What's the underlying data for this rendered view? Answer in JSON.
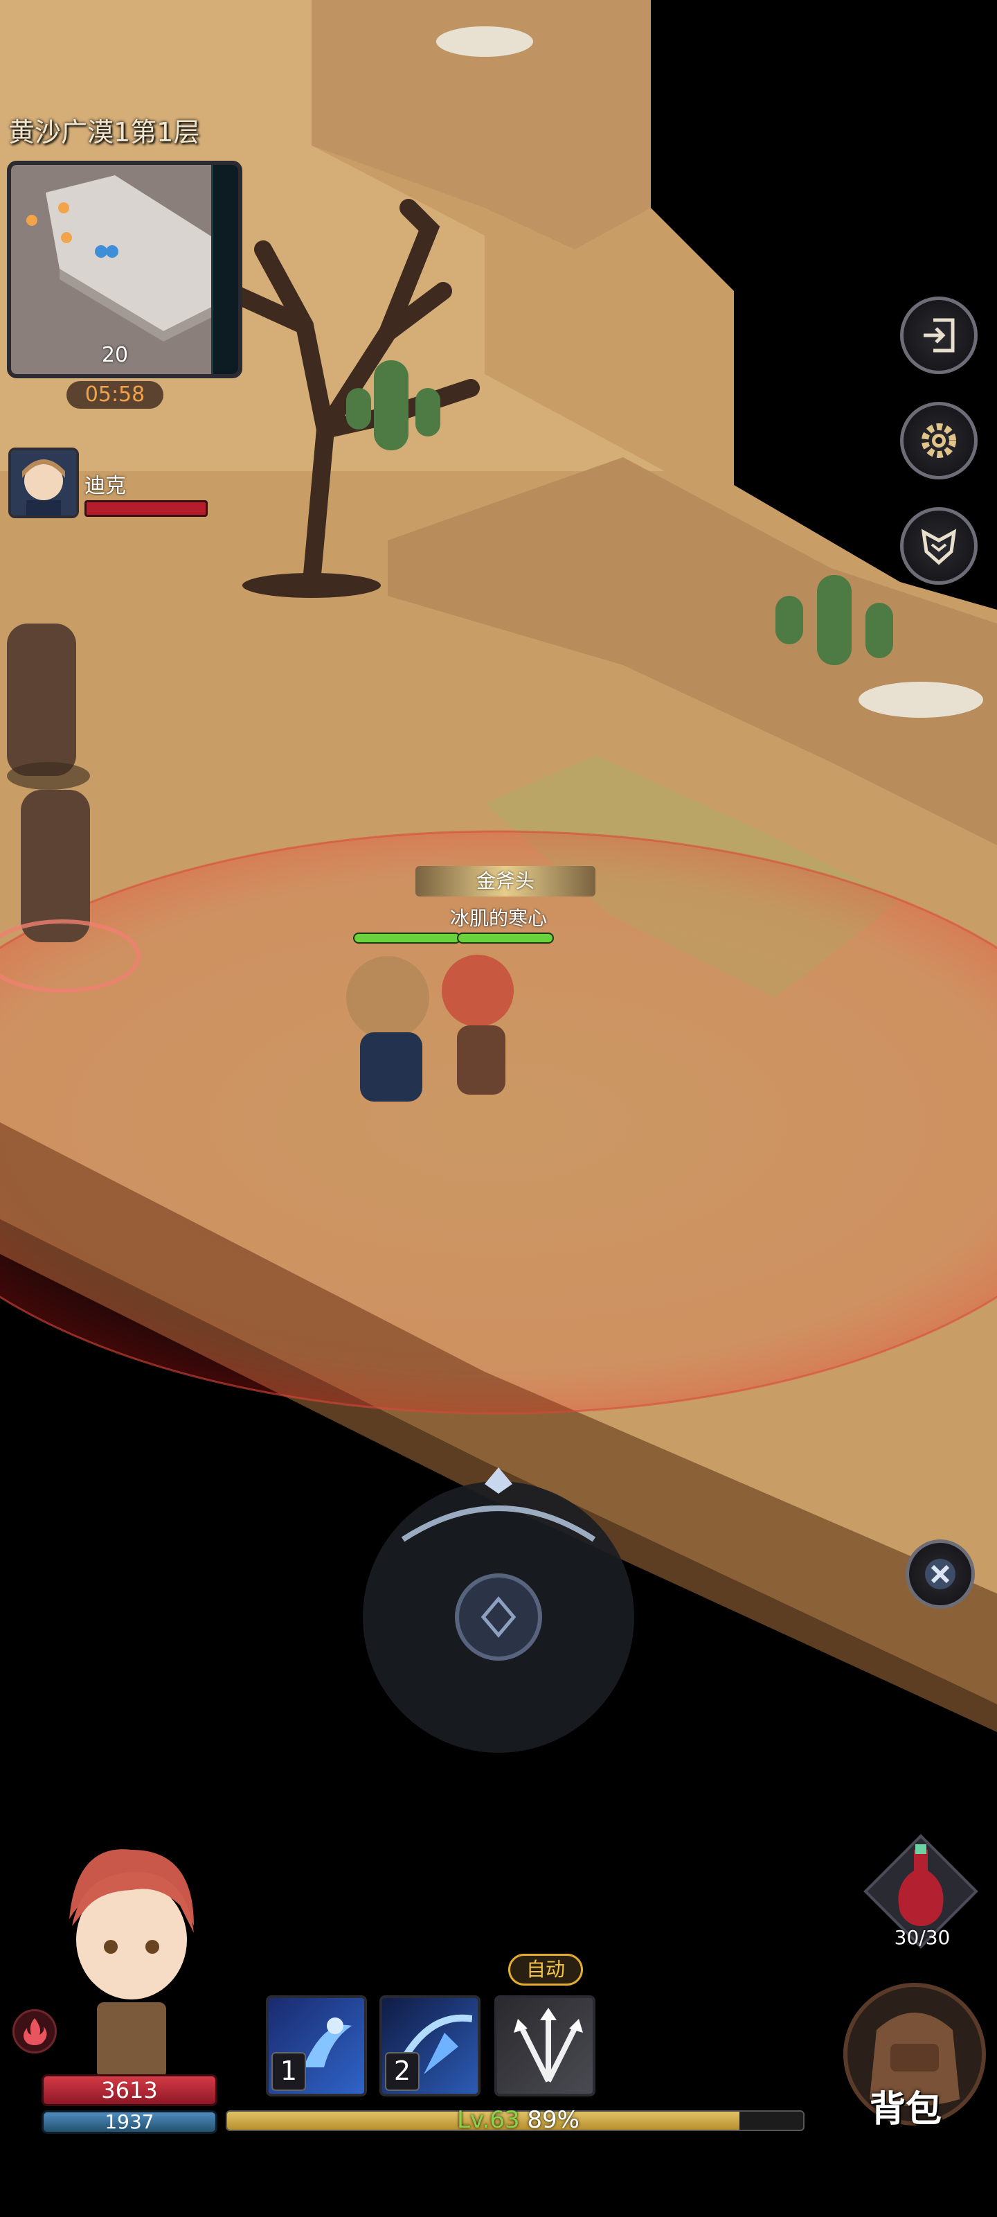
{
  "hud": {
    "area_title": "黄沙广漠1第1层",
    "minimap_level": "20",
    "timer": "05:58",
    "ally": {
      "name": "迪克"
    }
  },
  "character": {
    "title": "金斧头",
    "name": "冰肌的寒心"
  },
  "skills": [
    {
      "slot": "1",
      "icon": "sprint-icon"
    },
    {
      "slot": "2",
      "icon": "slash-icon"
    },
    {
      "slot": "",
      "icon": "arrow-burst-icon"
    }
  ],
  "auto_label": "自动",
  "player": {
    "hp": "3613",
    "mp": "1937",
    "level_text": "Lv.63",
    "exp_percent_text": "89%",
    "exp_fraction": 0.89
  },
  "potion": {
    "count": "30/30"
  },
  "bag_label": "背包",
  "buttons": [
    "exit-icon",
    "gear-icon",
    "guild-emblem-icon",
    "close-icon"
  ],
  "colors": {
    "sand": "#c9a06a",
    "hp": "#b61d2c",
    "mp": "#3d7aa8",
    "exp": "#d0ad4a",
    "accent_gold": "#e4ad2f"
  }
}
